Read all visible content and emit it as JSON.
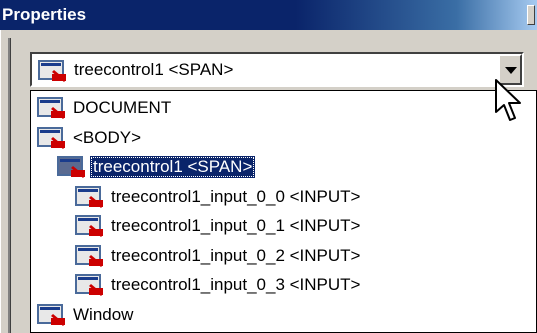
{
  "window": {
    "title": "Properties"
  },
  "combo": {
    "selected_text": "treecontrol1 <SPAN>",
    "icon": "html-element-icon"
  },
  "tree": {
    "items": [
      {
        "label": "DOCUMENT",
        "icon": "html-element-icon",
        "level": 0
      },
      {
        "label": "<BODY>",
        "icon": "html-element-icon",
        "level": 0
      },
      {
        "label": "treecontrol1 <SPAN>",
        "icon": "html-element-icon",
        "level": 1,
        "selected": true
      },
      {
        "label": "treecontrol1_input_0_0 <INPUT>",
        "icon": "html-element-icon",
        "level": 2
      },
      {
        "label": "treecontrol1_input_0_1 <INPUT>",
        "icon": "html-element-icon",
        "level": 2
      },
      {
        "label": "treecontrol1_input_0_2 <INPUT>",
        "icon": "html-element-icon",
        "level": 2
      },
      {
        "label": "treecontrol1_input_0_3 <INPUT>",
        "icon": "html-element-icon",
        "level": 2
      },
      {
        "label": "Window",
        "icon": "window-icon",
        "level": 0
      }
    ]
  },
  "colors": {
    "titlebar": "#0a246a",
    "selection": "#0a246a",
    "icon_red": "#cc0000",
    "face": "#d4d0c8"
  }
}
